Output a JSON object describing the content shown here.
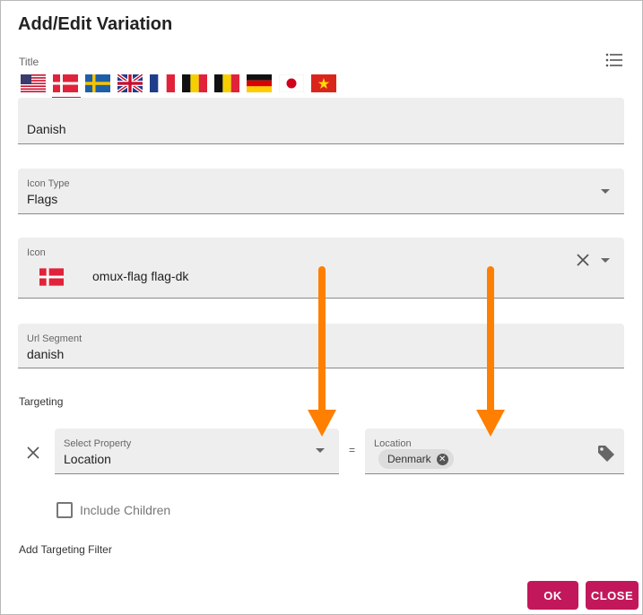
{
  "dialog": {
    "title": "Add/Edit Variation",
    "title_section_label": "Title",
    "flags": [
      {
        "code": "us",
        "icon": "flag-us-icon"
      },
      {
        "code": "dk",
        "icon": "flag-dk-icon",
        "active": true
      },
      {
        "code": "se",
        "icon": "flag-se-icon"
      },
      {
        "code": "gb",
        "icon": "flag-gb-icon"
      },
      {
        "code": "fr",
        "icon": "flag-fr-icon"
      },
      {
        "code": "be",
        "icon": "flag-be-icon"
      },
      {
        "code": "be2",
        "icon": "flag-be-icon"
      },
      {
        "code": "de",
        "icon": "flag-de-icon"
      },
      {
        "code": "jp",
        "icon": "flag-jp-icon"
      },
      {
        "code": "vn",
        "icon": "flag-vn-icon"
      }
    ],
    "title_field": {
      "value": "Danish"
    },
    "icon_type": {
      "label": "Icon Type",
      "value": "Flags"
    },
    "icon": {
      "label": "Icon",
      "value": "omux-flag flag-dk"
    },
    "url_segment": {
      "label": "Url Segment",
      "value": "danish"
    },
    "targeting": {
      "label": "Targeting",
      "property": {
        "label": "Select Property",
        "value": "Location"
      },
      "operator": "=",
      "location": {
        "label": "Location",
        "chip": "Denmark"
      }
    },
    "include_children": {
      "label": "Include Children",
      "checked": false
    },
    "add_filter_label": "Add Targeting Filter",
    "ok_label": "OK",
    "close_label": "CLOSE",
    "colors": {
      "accent": "#c2185b",
      "annotation_arrow": "#ff7f00",
      "field_bg": "#eeeeee"
    }
  }
}
